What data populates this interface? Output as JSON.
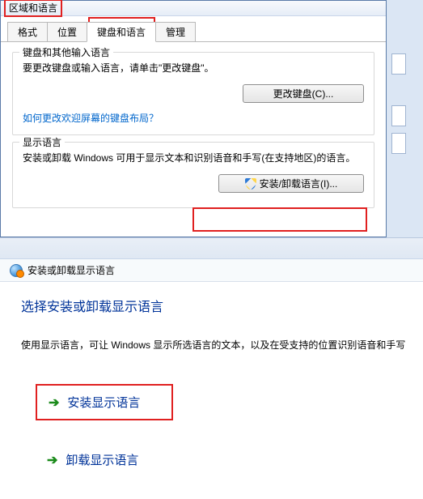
{
  "dialog": {
    "title": "区域和语言",
    "tabs": [
      {
        "label": "格式"
      },
      {
        "label": "位置"
      },
      {
        "label": "键盘和语言",
        "active": true
      },
      {
        "label": "管理"
      }
    ],
    "group_keyboard": {
      "title": "键盘和其他输入语言",
      "desc": "要更改键盘或输入语言，请单击\"更改键盘\"。",
      "button": "更改键盘(C)...",
      "link": "如何更改欢迎屏幕的键盘布局？"
    },
    "group_display": {
      "title": "显示语言",
      "desc": "安装或卸载 Windows 可用于显示文本和识别语音和手写(在支持地区)的语言。",
      "button": "安装/卸载语言(I)..."
    }
  },
  "wizard": {
    "header": "安装或卸载显示语言",
    "title": "选择安装或卸载显示语言",
    "desc": "使用显示语言，可让 Windows 显示所选语言的文本，以及在受支持的位置识别语音和手写",
    "install_label": "安装显示语言",
    "uninstall_label": "卸载显示语言"
  },
  "highlight_color": "#e02020"
}
